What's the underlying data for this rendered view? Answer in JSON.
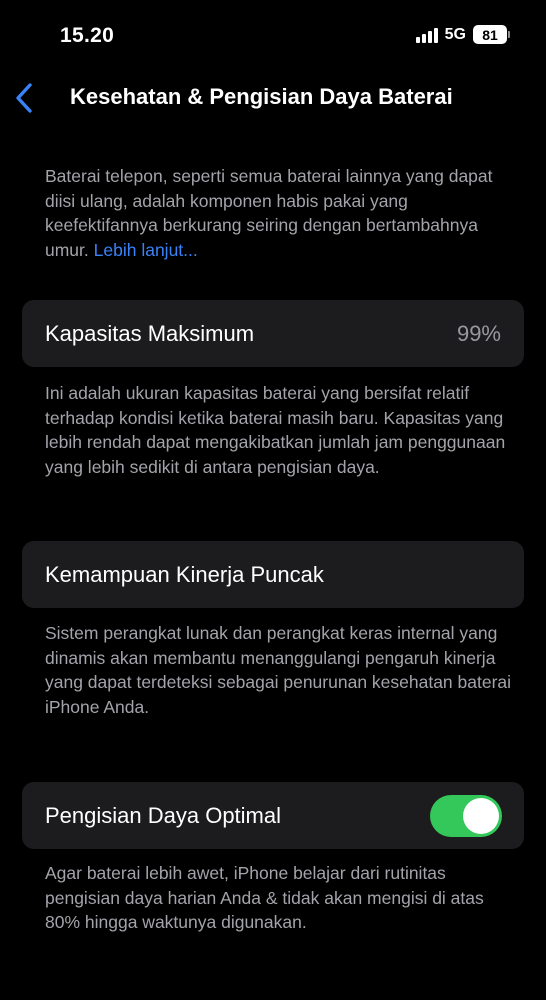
{
  "status_bar": {
    "time": "15.20",
    "network": "5G",
    "battery_level": "81"
  },
  "nav": {
    "back_icon": "chevron-left-icon",
    "title": "Kesehatan & Pengisian Daya Baterai"
  },
  "intro": {
    "text": "Baterai telepon, seperti semua baterai lainnya yang dapat diisi ulang, adalah komponen habis pakai yang keefektifannya berkurang seiring dengan bertambahnya umur. ",
    "link": "Lebih lanjut..."
  },
  "max_capacity": {
    "label": "Kapasitas Maksimum",
    "value": "99%",
    "footer": "Ini adalah ukuran kapasitas baterai yang bersifat relatif terhadap kondisi ketika baterai masih baru. Kapasitas yang lebih rendah dapat mengakibatkan jumlah jam penggunaan yang lebih sedikit di antara pengisian daya."
  },
  "peak_performance": {
    "label": "Kemampuan Kinerja Puncak",
    "footer": "Sistem perangkat lunak dan perangkat keras internal yang dinamis akan membantu menanggulangi pengaruh kinerja yang dapat terdeteksi sebagai penurunan kesehatan baterai iPhone Anda."
  },
  "optimized_charging": {
    "label": "Pengisian Daya Optimal",
    "enabled": true,
    "footer": "Agar baterai lebih awet, iPhone belajar dari rutinitas pengisian daya harian Anda & tidak akan mengisi di atas 80% hingga waktunya digunakan."
  },
  "colors": {
    "background": "#000000",
    "cell": "#1c1c1e",
    "accent_link": "#3a82f7",
    "toggle_on": "#34c759",
    "secondary_text": "#a3a3aa"
  }
}
